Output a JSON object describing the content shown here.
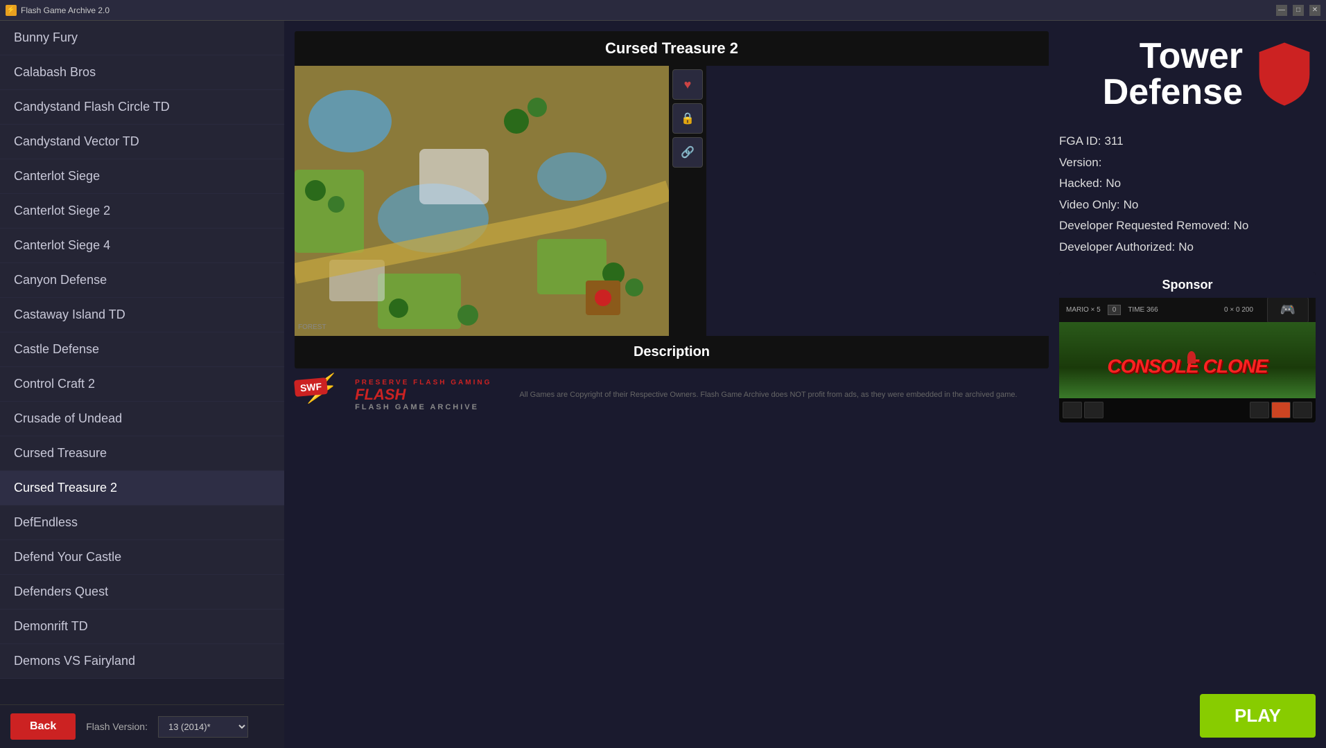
{
  "titleBar": {
    "title": "Flash Game Archive 2.0",
    "minimizeLabel": "—",
    "restoreLabel": "□",
    "closeLabel": "✕"
  },
  "sidebar": {
    "items": [
      {
        "id": "bunny-fury",
        "label": "Bunny Fury",
        "active": false
      },
      {
        "id": "calabash-bros",
        "label": "Calabash Bros",
        "active": false
      },
      {
        "id": "candystand-flash-circle-td",
        "label": "Candystand Flash Circle TD",
        "active": false
      },
      {
        "id": "candystand-vector-td",
        "label": "Candystand Vector TD",
        "active": false
      },
      {
        "id": "canterlot-siege",
        "label": "Canterlot Siege",
        "active": false
      },
      {
        "id": "canterlot-siege-2",
        "label": "Canterlot Siege 2",
        "active": false
      },
      {
        "id": "canterlot-siege-4",
        "label": "Canterlot Siege 4",
        "active": false
      },
      {
        "id": "canyon-defense",
        "label": "Canyon Defense",
        "active": false
      },
      {
        "id": "castaway-island-td",
        "label": "Castaway Island TD",
        "active": false
      },
      {
        "id": "castle-defense",
        "label": "Castle Defense",
        "active": false
      },
      {
        "id": "control-craft-2",
        "label": "Control Craft 2",
        "active": false
      },
      {
        "id": "crusade-of-undead",
        "label": "Crusade of Undead",
        "active": false
      },
      {
        "id": "cursed-treasure",
        "label": "Cursed Treasure",
        "active": false
      },
      {
        "id": "cursed-treasure-2",
        "label": "Cursed Treasure 2",
        "active": true
      },
      {
        "id": "defendless",
        "label": "DefEndless",
        "active": false
      },
      {
        "id": "defend-your-castle",
        "label": "Defend Your Castle",
        "active": false
      },
      {
        "id": "defenders-quest",
        "label": "Defenders Quest",
        "active": false
      },
      {
        "id": "demonrift-td",
        "label": "Demonrift TD",
        "active": false
      },
      {
        "id": "demons-vs-fairyland",
        "label": "Demons VS Fairyland",
        "active": false
      }
    ],
    "backButton": "Back",
    "flashVersionLabel": "Flash Version:",
    "flashVersionValue": "13 (2014)*"
  },
  "game": {
    "title": "Cursed Treasure 2",
    "descriptionLabel": "Description",
    "favoriteIcon": "♥",
    "lockIcon": "🔒",
    "linkIcon": "🔗"
  },
  "gameInfo": {
    "fgaIdLabel": "FGA ID:",
    "fgaIdValue": "311",
    "versionLabel": "Version:",
    "versionValue": "",
    "hackedLabel": "Hacked:",
    "hackedValue": "No",
    "videoOnlyLabel": "Video Only:",
    "videoOnlyValue": "No",
    "devRemovedLabel": "Developer Requested Removed:",
    "devRemovedValue": "No",
    "devAuthorizedLabel": "Developer Authorized:",
    "devAuthorizedValue": "No"
  },
  "genre": {
    "title": "Tower\nDefense",
    "shieldColor": "#cc2222"
  },
  "sponsor": {
    "title": "Sponsor",
    "gameName": "Console Clone"
  },
  "footer": {
    "swfBadge": "SWF",
    "preserveText": "PRESERVE FLASH GAMING",
    "archiveName": "FLASH GAME ARCHIVE",
    "copyright": "All Games are Copyright of their Respective Owners. Flash Game Archive does NOT profit from ads, as they were embedded in the archived game.",
    "playButton": "PLAY"
  }
}
